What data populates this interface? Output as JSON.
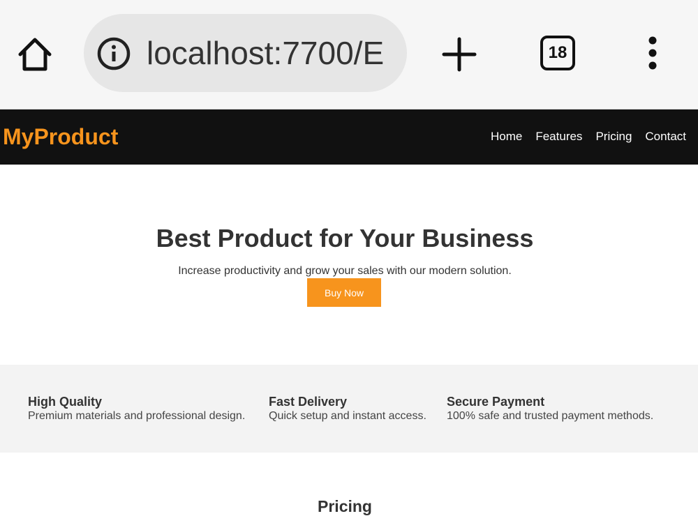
{
  "browser": {
    "url": "localhost:7700/E",
    "tab_count": "18",
    "icons": [
      "home-icon",
      "info-icon",
      "plus-icon",
      "tabs-icon",
      "more-vert-icon"
    ]
  },
  "site": {
    "brand": "MyProduct",
    "accent_color": "#f7941d",
    "nav": {
      "home": "Home",
      "features": "Features",
      "pricing": "Pricing",
      "contact": "Contact"
    }
  },
  "hero": {
    "title": "Best Product for Your Business",
    "subtitle": "Increase productivity and grow your sales with our modern solution.",
    "cta": "Buy Now"
  },
  "features": [
    {
      "title": "High Quality",
      "desc": "Premium materials and professional design."
    },
    {
      "title": "Fast Delivery",
      "desc": "Quick setup and instant access."
    },
    {
      "title": "Secure Payment",
      "desc": "100% safe and trusted payment methods."
    }
  ],
  "pricing": {
    "title": "Pricing"
  }
}
